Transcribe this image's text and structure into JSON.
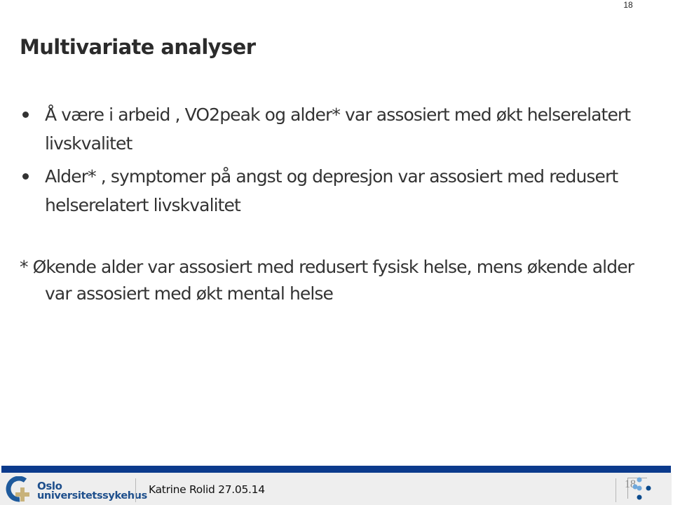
{
  "page": {
    "top_page_number": "18"
  },
  "slide": {
    "title": "Multivariate analyser",
    "bullets": [
      "Å være i arbeid , VO2peak og alder* var assosiert med økt helserelatert livskvalitet",
      "Alder* , symptomer på angst og depresjon var assosiert med redusert helserelatert livskvalitet"
    ],
    "footnote": "* Økende alder var assosiert med redusert fysisk helse, mens økende alder var assosiert med økt mental helse"
  },
  "footer": {
    "logo_line1": "Oslo",
    "logo_line2": "universitetssykehus",
    "author_date": "Katrine Rolid 27.05.14",
    "slide_number": "18",
    "colors": {
      "bar": "#0b3a8c",
      "logo_blue": "#1e4f8c",
      "logo_cross": "#c8b27a",
      "dot_light": "#6fa8dc",
      "dot_dark": "#0b4a8c"
    }
  }
}
